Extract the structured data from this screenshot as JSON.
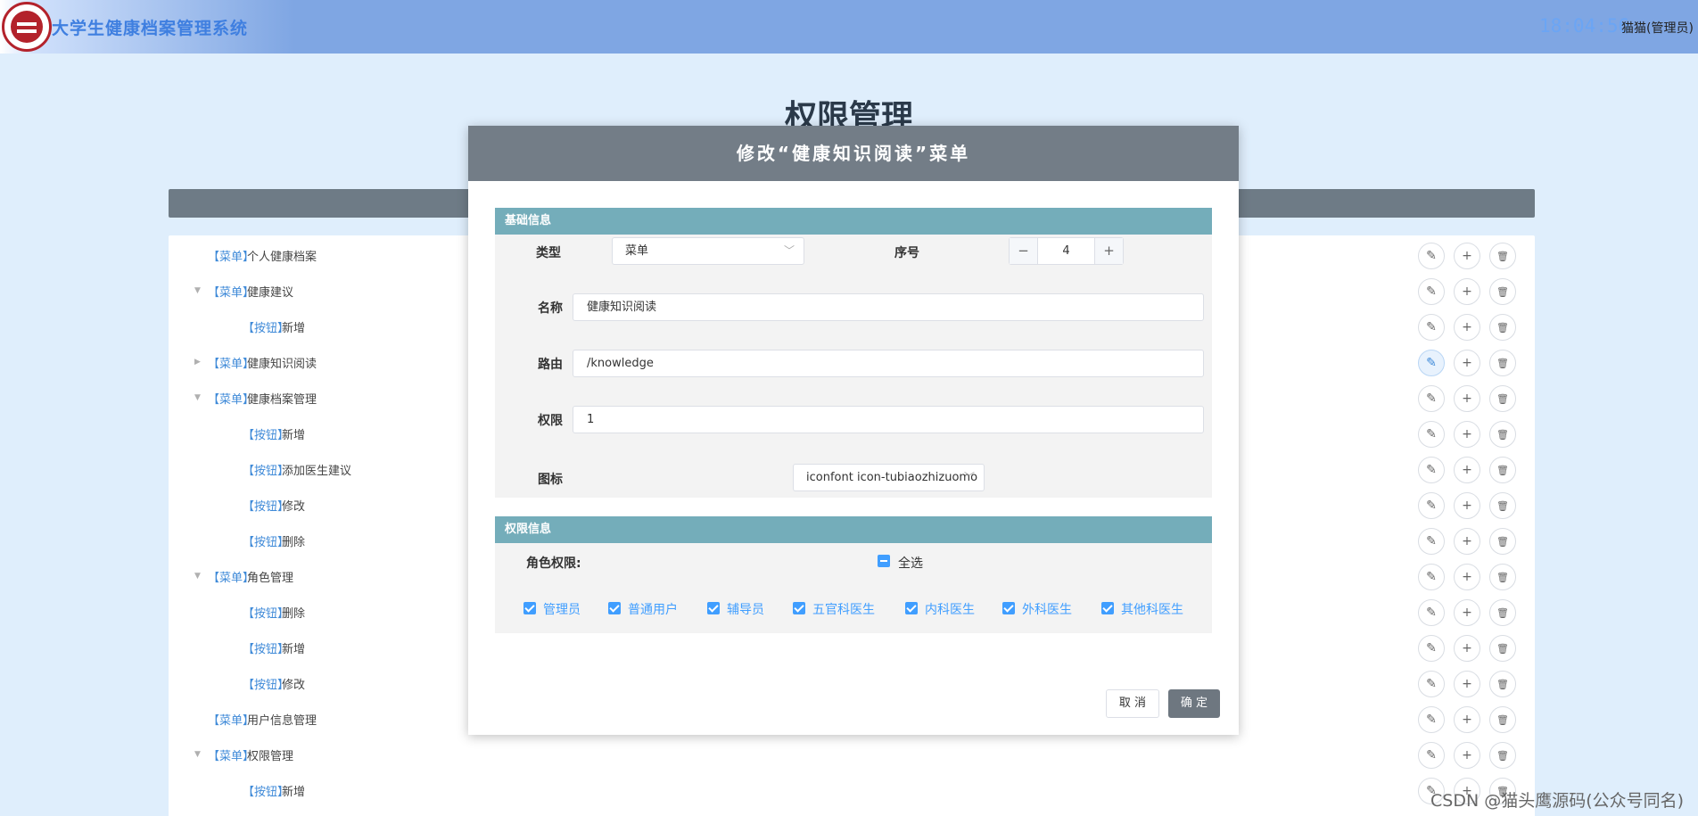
{
  "header": {
    "app_title": "大学生健康档案管理系统",
    "clock": "18:04:56",
    "user": "猫猫(管理员)"
  },
  "page": {
    "title": "权限管理"
  },
  "tree": {
    "rows": [
      {
        "tag": "【菜单】",
        "name": "个人健康档案",
        "level": 0,
        "arrow": ""
      },
      {
        "tag": "【菜单】",
        "name": "健康建议",
        "level": 0,
        "arrow": "▼"
      },
      {
        "tag": "【按钮】",
        "name": "新增",
        "level": 1,
        "arrow": ""
      },
      {
        "tag": "【菜单】",
        "name": "健康知识阅读",
        "level": 0,
        "arrow": "▶"
      },
      {
        "tag": "【菜单】",
        "name": "健康档案管理",
        "level": 0,
        "arrow": "▼"
      },
      {
        "tag": "【按钮】",
        "name": "新增",
        "level": 1,
        "arrow": ""
      },
      {
        "tag": "【按钮】",
        "name": "添加医生建议",
        "level": 1,
        "arrow": ""
      },
      {
        "tag": "【按钮】",
        "name": "修改",
        "level": 1,
        "arrow": ""
      },
      {
        "tag": "【按钮】",
        "name": "删除",
        "level": 1,
        "arrow": ""
      },
      {
        "tag": "【菜单】",
        "name": "角色管理",
        "level": 0,
        "arrow": "▼"
      },
      {
        "tag": "【按钮】",
        "name": "删除",
        "level": 1,
        "arrow": ""
      },
      {
        "tag": "【按钮】",
        "name": "新增",
        "level": 1,
        "arrow": ""
      },
      {
        "tag": "【按钮】",
        "name": "修改",
        "level": 1,
        "arrow": ""
      },
      {
        "tag": "【菜单】",
        "name": "用户信息管理",
        "level": 0,
        "arrow": ""
      },
      {
        "tag": "【菜单】",
        "name": "权限管理",
        "level": 0,
        "arrow": "▼"
      },
      {
        "tag": "【按钮】",
        "name": "新增",
        "level": 1,
        "arrow": ""
      }
    ],
    "active_edit_row": 3,
    "icons": {
      "edit": "pencil-icon",
      "add": "plus-icon",
      "delete": "trash-icon"
    }
  },
  "dialog": {
    "title": "修改“健康知识阅读”菜单",
    "basic_section": "基础信息",
    "type_label": "类型",
    "type_value": "菜单",
    "order_label": "序号",
    "order_value": "4",
    "name_label": "名称",
    "name_value": "健康知识阅读",
    "route_label": "路由",
    "route_value": "/knowledge",
    "perm_label": "权限",
    "perm_value": "1",
    "icon_label": "图标",
    "icon_value": "iconfont icon-tubiaozhizuomo",
    "perm_section": "权限信息",
    "role_label": "角色权限:",
    "select_all": "全选",
    "roles": [
      "管理员",
      "普通用户",
      "辅导员",
      "五官科医生",
      "内科医生",
      "外科医生",
      "其他科医生"
    ],
    "cancel": "取 消",
    "confirm": "确 定"
  },
  "watermark": "CSDN @猫头鹰源码(公众号同名)",
  "colors": {
    "header": "#7fa6e3",
    "dialog_head": "#737d87",
    "section_bar": "#74adba",
    "checkbox": "#409eff"
  }
}
